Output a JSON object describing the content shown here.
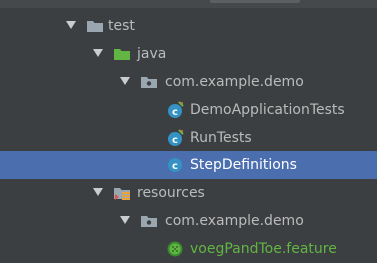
{
  "project_tree": {
    "items": [
      {
        "label": "test",
        "kind": "folder",
        "expanded": true,
        "icon": "folder-icon",
        "color": "#9aa7b0"
      },
      {
        "label": "java",
        "kind": "source-folder",
        "expanded": true,
        "icon": "test-source-folder-icon",
        "color": "#62b543"
      },
      {
        "label": "com.example.demo",
        "kind": "package",
        "expanded": true,
        "icon": "package-icon",
        "color": "#9aa7b0"
      },
      {
        "label": "DemoApplicationTests",
        "kind": "test-class",
        "icon": "test-class-icon",
        "color": "#3592c4"
      },
      {
        "label": "RunTests",
        "kind": "test-class",
        "icon": "test-class-icon",
        "color": "#3592c4"
      },
      {
        "label": "StepDefinitions",
        "kind": "class",
        "icon": "class-icon",
        "color": "#3592c4",
        "selected": true
      },
      {
        "label": "resources",
        "kind": "resources-folder",
        "expanded": true,
        "icon": "resources-folder-icon",
        "color": "#9aa7b0"
      },
      {
        "label": "com.example.demo",
        "kind": "package",
        "expanded": true,
        "icon": "package-icon",
        "color": "#9aa7b0"
      },
      {
        "label": "voegPandToe.feature",
        "kind": "feature-file",
        "icon": "cucumber-icon",
        "color": "#62b543"
      }
    ]
  },
  "colors": {
    "background": "#3c3f41",
    "selection": "#4b6eaf",
    "text": "#bbbbbb",
    "feature_text": "#62b543"
  }
}
